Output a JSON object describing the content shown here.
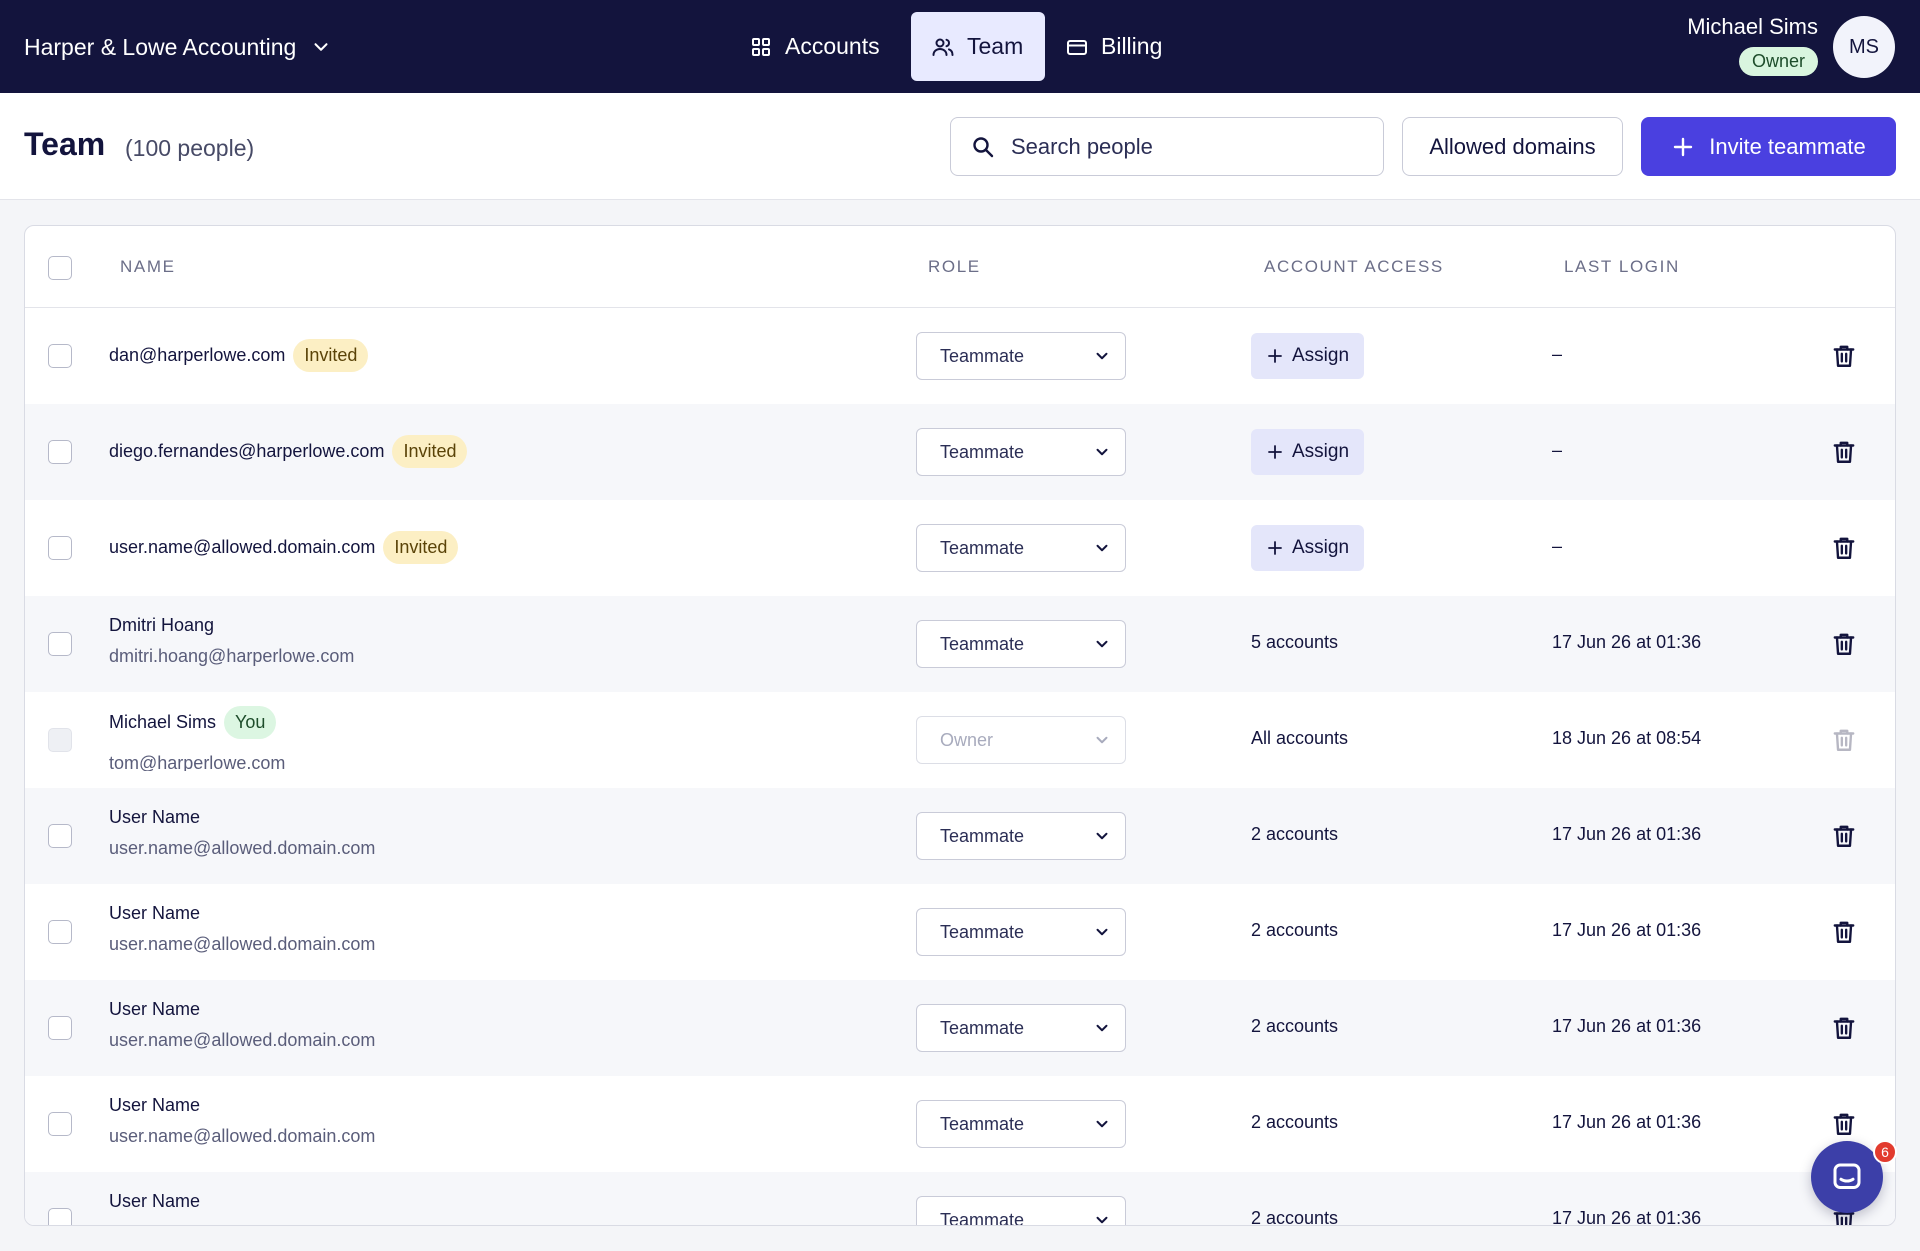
{
  "org": {
    "name": "Harper & Lowe Accounting"
  },
  "nav": {
    "tabs": [
      {
        "label": "Accounts",
        "icon": "grid-icon",
        "active": false
      },
      {
        "label": "Team",
        "icon": "people-icon",
        "active": true
      },
      {
        "label": "Billing",
        "icon": "card-icon",
        "active": false
      }
    ]
  },
  "user": {
    "name": "Michael Sims",
    "role_badge": "Owner",
    "initials": "MS"
  },
  "page": {
    "title": "Team",
    "count": "(100 people)",
    "search_placeholder": "Search people",
    "allowed_domains_label": "Allowed domains",
    "invite_label": "Invite teammate"
  },
  "table": {
    "columns": [
      "NAME",
      "ROLE",
      "ACCOUNT ACCESS",
      "LAST LOGIN"
    ],
    "rows": [
      {
        "primary": "dan@harperlowe.com",
        "badge": "Invited",
        "secondary": "",
        "role": "Teammate",
        "access": "Assign",
        "last_login": "–"
      },
      {
        "primary": "diego.fernandes@harperlowe.com",
        "badge": "Invited",
        "secondary": "",
        "role": "Teammate",
        "access": "Assign",
        "last_login": "–"
      },
      {
        "primary": "user.name@allowed.domain.com",
        "badge": "Invited",
        "secondary": "",
        "role": "Teammate",
        "access": "Assign",
        "last_login": "–"
      },
      {
        "primary": "Dmitri Hoang",
        "badge": "",
        "secondary": "dmitri.hoang@harperlowe.com",
        "role": "Teammate",
        "access": "5 accounts",
        "last_login": "17 Jun 26 at 01:36"
      },
      {
        "primary": "Michael Sims",
        "badge": "You",
        "secondary": "tom@harperlowe.com",
        "role": "Owner",
        "access": "All accounts",
        "last_login": "18 Jun 26 at 08:54"
      },
      {
        "primary": "User Name",
        "badge": "",
        "secondary": "user.name@allowed.domain.com",
        "role": "Teammate",
        "access": "2 accounts",
        "last_login": "17 Jun 26 at 01:36"
      },
      {
        "primary": "User Name",
        "badge": "",
        "secondary": "user.name@allowed.domain.com",
        "role": "Teammate",
        "access": "2 accounts",
        "last_login": "17 Jun 26 at 01:36"
      },
      {
        "primary": "User Name",
        "badge": "",
        "secondary": "user.name@allowed.domain.com",
        "role": "Teammate",
        "access": "2 accounts",
        "last_login": "17 Jun 26 at 01:36"
      },
      {
        "primary": "User Name",
        "badge": "",
        "secondary": "user.name@allowed.domain.com",
        "role": "Teammate",
        "access": "2 accounts",
        "last_login": "17 Jun 26 at 01:36"
      },
      {
        "primary": "User Name",
        "badge": "",
        "secondary": "",
        "role": "Teammate",
        "access": "2 accounts",
        "last_login": "17 Jun 26 at 01:36"
      }
    ]
  },
  "chat": {
    "unread_count": "6"
  },
  "colors": {
    "nav_bg": "#13143d",
    "accent": "#4a40e0",
    "invited_badge": "#fcefc4",
    "you_badge": "#dcf6e2",
    "chat_badge": "#e23b2e"
  }
}
